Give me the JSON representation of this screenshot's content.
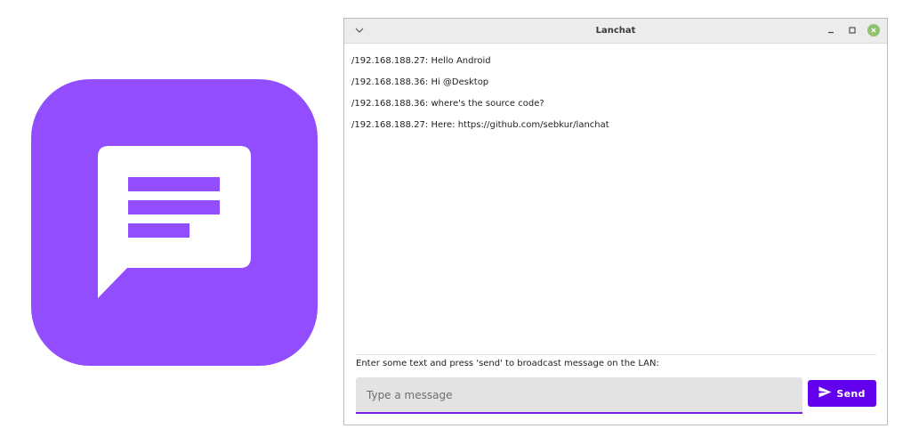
{
  "colors": {
    "icon_background": "#914dfe",
    "accent": "#6200ee",
    "input_underline": "#7a1fe5",
    "close_button": "#8fc36f"
  },
  "icons": {
    "app": "chat-bubble-icon",
    "window_menu": "chevron-down-icon",
    "minimize": "minimize-icon",
    "maximize": "maximize-icon",
    "close": "close-icon",
    "send": "send-arrow-icon"
  },
  "window": {
    "title": "Lanchat"
  },
  "messages": [
    "/192.168.188.27: Hello Android",
    "/192.168.188.36: Hi @Desktop",
    "/192.168.188.36: where's the source code?",
    "/192.168.188.27: Here: https://github.com/sebkur/lanchat"
  ],
  "composer": {
    "hint": "Enter some text and press 'send' to broadcast message on the LAN:",
    "placeholder": "Type a message",
    "value": "",
    "send_label": "Send"
  }
}
